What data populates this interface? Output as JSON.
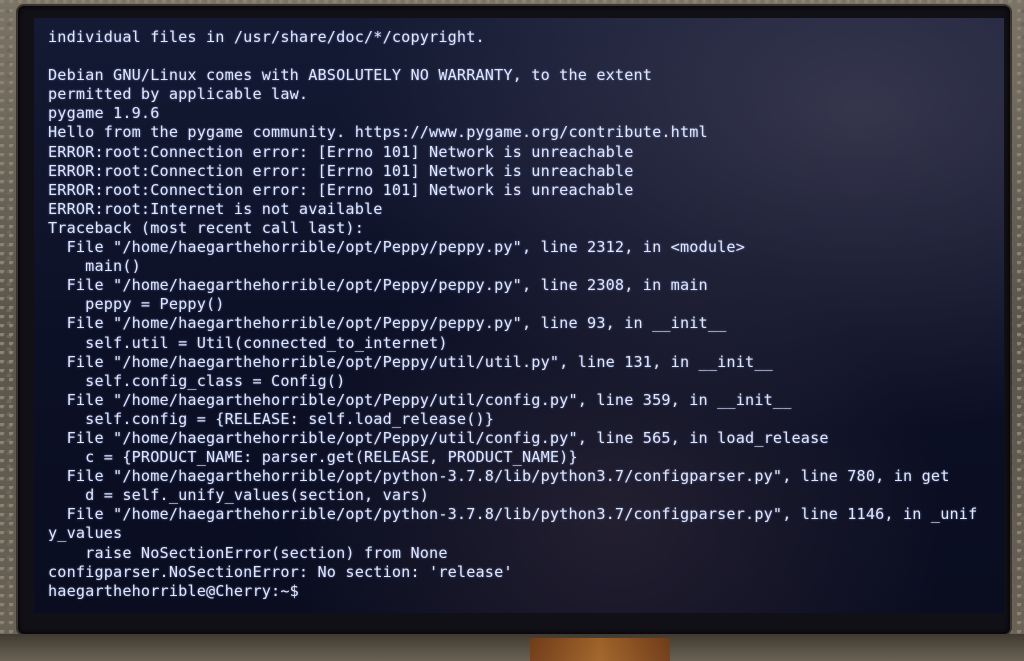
{
  "terminal": {
    "lines": [
      "individual files in /usr/share/doc/*/copyright.",
      "",
      "Debian GNU/Linux comes with ABSOLUTELY NO WARRANTY, to the extent",
      "permitted by applicable law.",
      "pygame 1.9.6",
      "Hello from the pygame community. https://www.pygame.org/contribute.html",
      "ERROR:root:Connection error: [Errno 101] Network is unreachable",
      "ERROR:root:Connection error: [Errno 101] Network is unreachable",
      "ERROR:root:Connection error: [Errno 101] Network is unreachable",
      "ERROR:root:Internet is not available",
      "Traceback (most recent call last):",
      "  File \"/home/haegarthehorrible/opt/Peppy/peppy.py\", line 2312, in <module>",
      "    main()",
      "  File \"/home/haegarthehorrible/opt/Peppy/peppy.py\", line 2308, in main",
      "    peppy = Peppy()",
      "  File \"/home/haegarthehorrible/opt/Peppy/peppy.py\", line 93, in __init__",
      "    self.util = Util(connected_to_internet)",
      "  File \"/home/haegarthehorrible/opt/Peppy/util/util.py\", line 131, in __init__",
      "    self.config_class = Config()",
      "  File \"/home/haegarthehorrible/opt/Peppy/util/config.py\", line 359, in __init__",
      "    self.config = {RELEASE: self.load_release()}",
      "  File \"/home/haegarthehorrible/opt/Peppy/util/config.py\", line 565, in load_release",
      "    c = {PRODUCT_NAME: parser.get(RELEASE, PRODUCT_NAME)}",
      "  File \"/home/haegarthehorrible/opt/python-3.7.8/lib/python3.7/configparser.py\", line 780, in get",
      "    d = self._unify_values(section, vars)",
      "  File \"/home/haegarthehorrible/opt/python-3.7.8/lib/python3.7/configparser.py\", line 1146, in _unif",
      "y_values",
      "    raise NoSectionError(section) from None",
      "configparser.NoSectionError: No section: 'release'",
      "haegarthehorrible@Cherry:~$"
    ]
  }
}
